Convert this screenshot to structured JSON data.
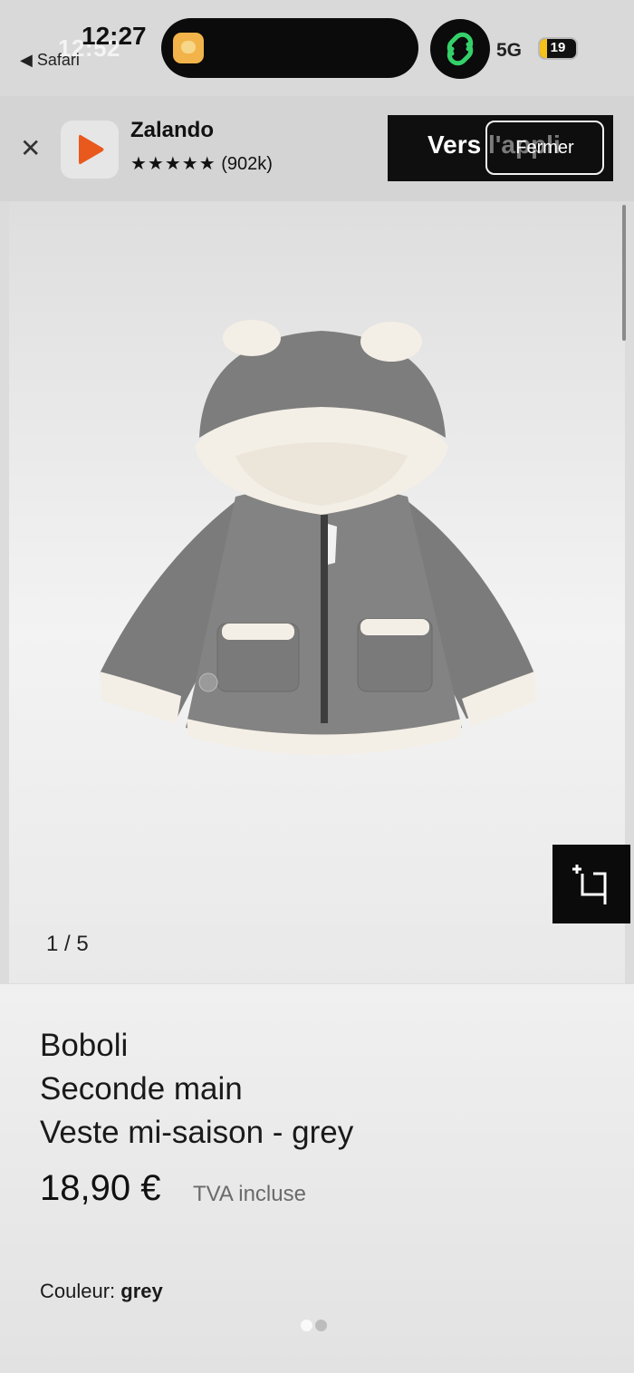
{
  "status_bar": {
    "time_overlay": "12:52",
    "time": "12:27",
    "back_app": "◀ Safari",
    "network": "5G",
    "battery": "19",
    "battery_level": 0.19
  },
  "app_banner": {
    "app_name": "Zalando",
    "stars": "★★★★★",
    "rating_count": "(902k)",
    "open_app_label": "Vers l'appli",
    "close_label": "Fermer"
  },
  "gallery": {
    "counter": "1 / 5"
  },
  "product": {
    "brand": "Boboli",
    "condition": "Seconde main",
    "name": "Veste mi-saison - grey",
    "price": "18,90 €",
    "vat_note": "TVA incluse",
    "color_label": "Couleur:",
    "color_value": "grey"
  },
  "page_dots": {
    "count": 2,
    "active": 1
  },
  "colors": {
    "zalando_orange": "#e9581d",
    "link_green": "#35d06a",
    "battery_yellow": "#f4c21a",
    "jacket_grey": "#7b7b7b",
    "sherpa_white": "#f4efe6"
  },
  "icons": [
    "close-icon",
    "zalando-logo-icon",
    "link-icon",
    "battery-icon",
    "zoom-crop-icon"
  ]
}
